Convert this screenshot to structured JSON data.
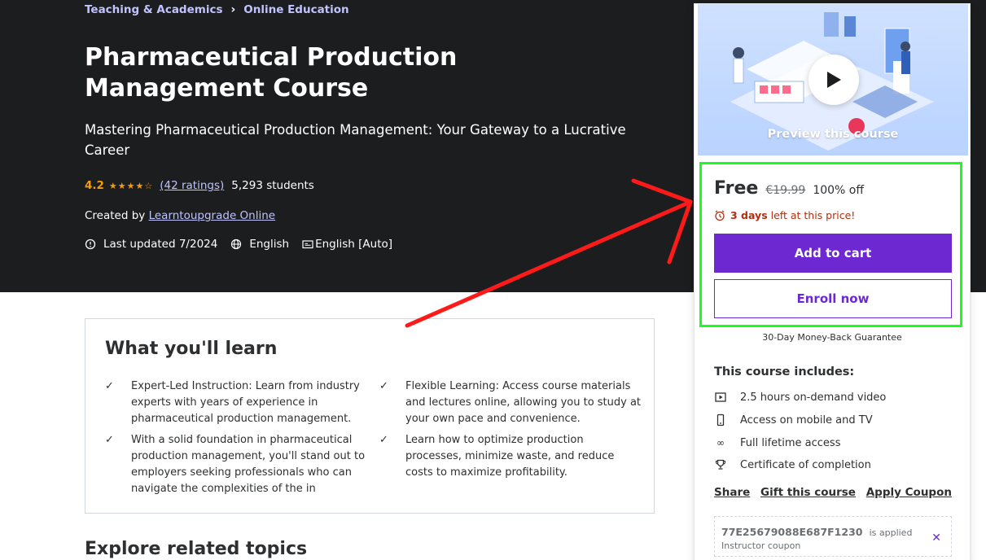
{
  "breadcrumb": {
    "items": [
      "Teaching & Academics",
      "Online Education"
    ],
    "separator": "›"
  },
  "course": {
    "title": "Pharmaceutical Production Management Course",
    "headline": "Mastering Pharmaceutical Production Management: Your Gateway to a Lucrative Career",
    "rating": "4.2",
    "ratings_count": "(42 ratings)",
    "students": "5,293 students",
    "created_by_label": "Created by",
    "instructor": "Learntoupgrade Online",
    "last_updated": "Last updated 7/2024",
    "language": "English",
    "captions": "English [Auto]"
  },
  "learn": {
    "title": "What you'll learn",
    "items": [
      "Expert-Led Instruction: Learn from industry experts with years of experience in pharmaceutical production management.",
      "Flexible Learning: Access course materials and lectures online, allowing you to study at your own pace and convenience.",
      "With a solid foundation in pharmaceutical production management, you'll stand out to employers seeking professionals who can navigate the complexities of the in",
      "Learn how to optimize production processes, minimize waste, and reduce costs to maximize profitability."
    ]
  },
  "explore_title": "Explore related topics",
  "sidebar": {
    "preview_label": "Preview this course",
    "price": "Free",
    "original_price": "€19.99",
    "discount": "100% off",
    "timer_bold": "3 days",
    "timer_rest": "left at this price!",
    "add_to_cart": "Add to cart",
    "enroll_now": "Enroll now",
    "guarantee": "30-Day Money-Back Guarantee",
    "includes_title": "This course includes:",
    "includes": [
      {
        "icon": "video-icon",
        "label": "2.5 hours on-demand video"
      },
      {
        "icon": "mobile-icon",
        "label": "Access on mobile and TV"
      },
      {
        "icon": "infinity-icon",
        "label": "Full lifetime access"
      },
      {
        "icon": "trophy-icon",
        "label": "Certificate of completion"
      }
    ],
    "links": {
      "share": "Share",
      "gift": "Gift this course",
      "coupon": "Apply Coupon"
    },
    "coupon": {
      "code": "77E25679088E687F1230",
      "applied": "is applied",
      "label": "Instructor coupon"
    }
  },
  "colors": {
    "accent": "#6d28d2",
    "hero_bg": "#1c1d1f",
    "rating": "#f69c08",
    "highlight": "#1aff1a",
    "annotation_arrow": "#ff1a1a"
  }
}
